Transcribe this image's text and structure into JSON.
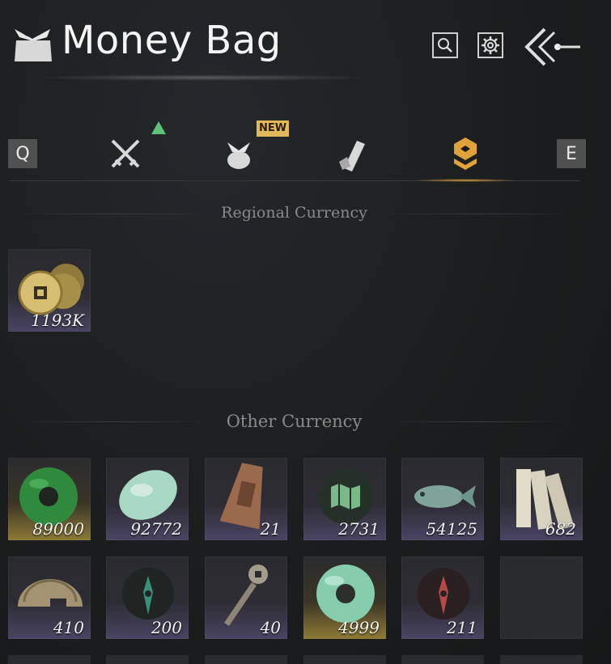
{
  "header": {
    "title": "Money Bag",
    "title_icon": "money-bag-icon",
    "buttons": [
      {
        "name": "search-button",
        "icon": "search-icon"
      },
      {
        "name": "settings-button",
        "icon": "gear-icon"
      },
      {
        "name": "back-button",
        "icon": "back-arrow-icon"
      }
    ]
  },
  "tabs": {
    "prev_key": "Q",
    "next_key": "E",
    "new_badge": "NEW",
    "items": [
      {
        "icon": "crossed-swords-icon",
        "indicator": "upgrade-arrow"
      },
      {
        "icon": "bundle-icon",
        "badge": "NEW"
      },
      {
        "icon": "scroll-icon"
      },
      {
        "icon": "currency-icon",
        "active": true
      }
    ]
  },
  "regional": {
    "label": "Regional Currency",
    "items": [
      {
        "icon": "copper-coins-icon",
        "count": "1193K",
        "rarity": "common"
      }
    ]
  },
  "other": {
    "label": "Other Currency",
    "items": [
      {
        "icon": "green-jade-ring-icon",
        "count": "89000",
        "rarity": "gold"
      },
      {
        "icon": "pale-jade-stone-icon",
        "count": "92772",
        "rarity": "common"
      },
      {
        "icon": "bronze-token-icon",
        "count": "21",
        "rarity": "common"
      },
      {
        "icon": "map-icon",
        "count": "2731",
        "rarity": "common"
      },
      {
        "icon": "jade-fish-icon",
        "count": "54125",
        "rarity": "common"
      },
      {
        "icon": "paper-slips-icon",
        "count": "682",
        "rarity": "common"
      },
      {
        "icon": "half-coin-icon",
        "count": "410",
        "rarity": "common"
      },
      {
        "icon": "green-flame-icon",
        "count": "200",
        "rarity": "common"
      },
      {
        "icon": "coin-sword-icon",
        "count": "40",
        "rarity": "common"
      },
      {
        "icon": "light-jade-ring-icon",
        "count": "4999",
        "rarity": "gold"
      },
      {
        "icon": "red-flame-icon",
        "count": "211",
        "rarity": "common"
      },
      {
        "icon": "",
        "count": "",
        "rarity": "empty"
      }
    ]
  },
  "colors": {
    "accent_gold": "#e1b85a",
    "tab_indicator": "#d59a3a",
    "rarity_common": "#4a4462",
    "rarity_gold": "#8c7a36"
  }
}
